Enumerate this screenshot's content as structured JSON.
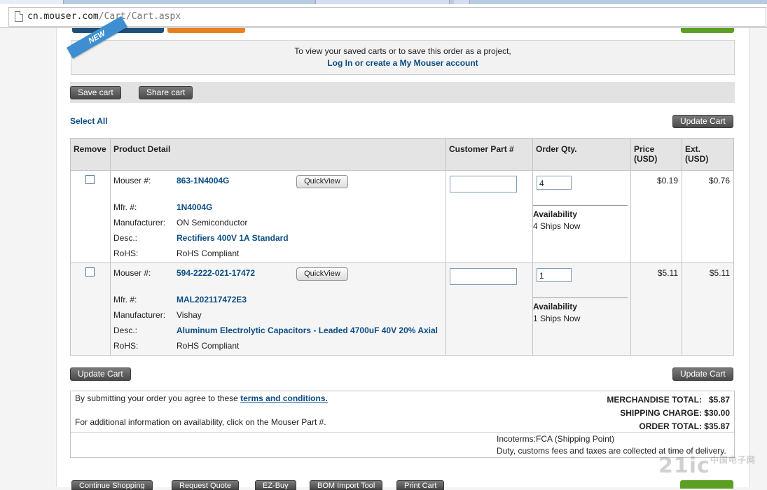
{
  "browser": {
    "url_host": "cn.mouser.com",
    "url_path": "/Cart/Cart.aspx"
  },
  "login_prompt": {
    "badge": "NEW",
    "line1": "To view your saved carts or to save this order as a project,",
    "line2": "Log In or create a My Mouser account"
  },
  "cart_actions": {
    "save_cart": "Save cart",
    "share_cart": "Share cart",
    "select_all": "Select All",
    "update_cart": "Update Cart"
  },
  "table": {
    "headers": {
      "remove": "Remove",
      "product_detail": "Product Detail",
      "customer_part": "Customer Part #",
      "order_qty": "Order Qty.",
      "price": "Price\n(USD)",
      "ext": "Ext.\n(USD)"
    },
    "labels": {
      "mouser": "Mouser #:",
      "mfr": "Mfr. #:",
      "manufacturer": "Manufacturer:",
      "desc": "Desc.:",
      "rohs": "RoHS:",
      "quickview": "QuickView",
      "availability": "Availability"
    },
    "rows": [
      {
        "mouser_no": "863-1N4004G",
        "mfr_no": "1N4004G",
        "manufacturer": "ON Semiconductor",
        "desc": "Rectifiers 400V 1A Standard",
        "rohs": "RoHS Compliant",
        "customer_part": "",
        "qty": "4",
        "availability": "4 Ships Now",
        "price": "$0.19",
        "ext": "$0.76"
      },
      {
        "mouser_no": "594-2222-021-17472",
        "mfr_no": "MAL202117472E3",
        "manufacturer": "Vishay",
        "desc": "Aluminum Electrolytic Capacitors - Leaded 4700uF 40V 20% Axial",
        "rohs": "RoHS Compliant",
        "customer_part": "",
        "qty": "1",
        "availability": "1 Ships Now",
        "price": "$5.11",
        "ext": "$5.11"
      }
    ]
  },
  "summary": {
    "terms_text": "By submitting your order you agree to these ",
    "terms_link": "terms and conditions.",
    "info_text": "For additional information on availability, click on the Mouser Part #.",
    "merch_label": "MERCHANDISE TOTAL:",
    "merch_value": "$5.87",
    "ship_label": "SHIPPING CHARGE:",
    "ship_value": "$30.00",
    "order_label": "ORDER TOTAL:",
    "order_value": "$35.87",
    "incoterms": "Incoterms:FCA (Shipping Point)",
    "duty": "Duty, customs fees and taxes are collected at time of delivery."
  },
  "bottom_buttons": {
    "continue": "Continue Shopping",
    "quote": "Request Quote",
    "ezbuy": "EZ-Buy",
    "bom": "BOM Import Tool",
    "print": "Print Cart"
  },
  "watermark": "21ic",
  "watermark_cn": "中国电子网"
}
